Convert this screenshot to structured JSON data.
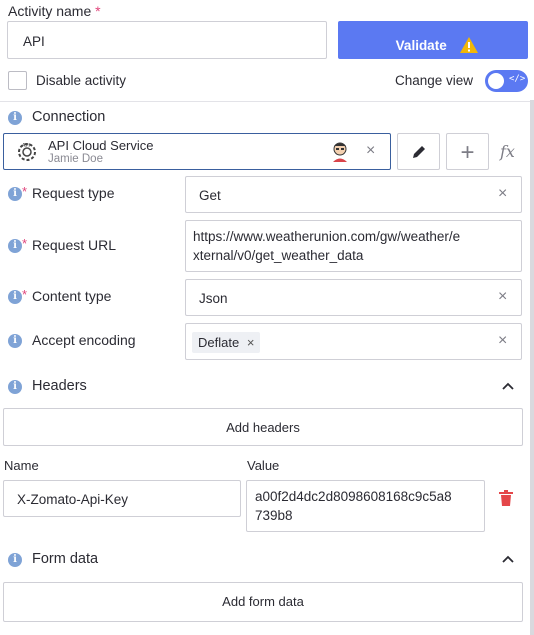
{
  "header": {
    "activity_name_label": "Activity name",
    "required_star": "*",
    "activity_name_value": "API",
    "validate_label": "Validate",
    "disable_activity_label": "Disable activity",
    "change_view_label": "Change view"
  },
  "connection": {
    "label": "Connection",
    "service_name": "API Cloud Service",
    "user_name": "Jamie Doe"
  },
  "request_type": {
    "label": "Request type",
    "value": "Get"
  },
  "request_url": {
    "label": "Request URL",
    "line1": "https://www.weatherunion.com/gw/weather/e",
    "line2": "xternal/v0/get_weather_data"
  },
  "content_type": {
    "label": "Content type",
    "value": "Json"
  },
  "accept_encoding": {
    "label": "Accept encoding",
    "tag": "Deflate"
  },
  "headers": {
    "title": "Headers",
    "add_label": "Add headers",
    "name_col": "Name",
    "value_col": "Value",
    "row_name": "X-Zomato-Api-Key",
    "row_value_line1": "a00f2d4dc2d8098608168c9c5a8",
    "row_value_line2": "739b8"
  },
  "form_data": {
    "title": "Form data",
    "add_label": "Add form data"
  },
  "icons": {
    "info": "i",
    "clear": "×",
    "fx": "fx",
    "plus": "+"
  },
  "colors": {
    "accent": "#5b79f2",
    "warning": "#f2b705",
    "delete": "#e4474a",
    "info": "#7fa3d6"
  }
}
